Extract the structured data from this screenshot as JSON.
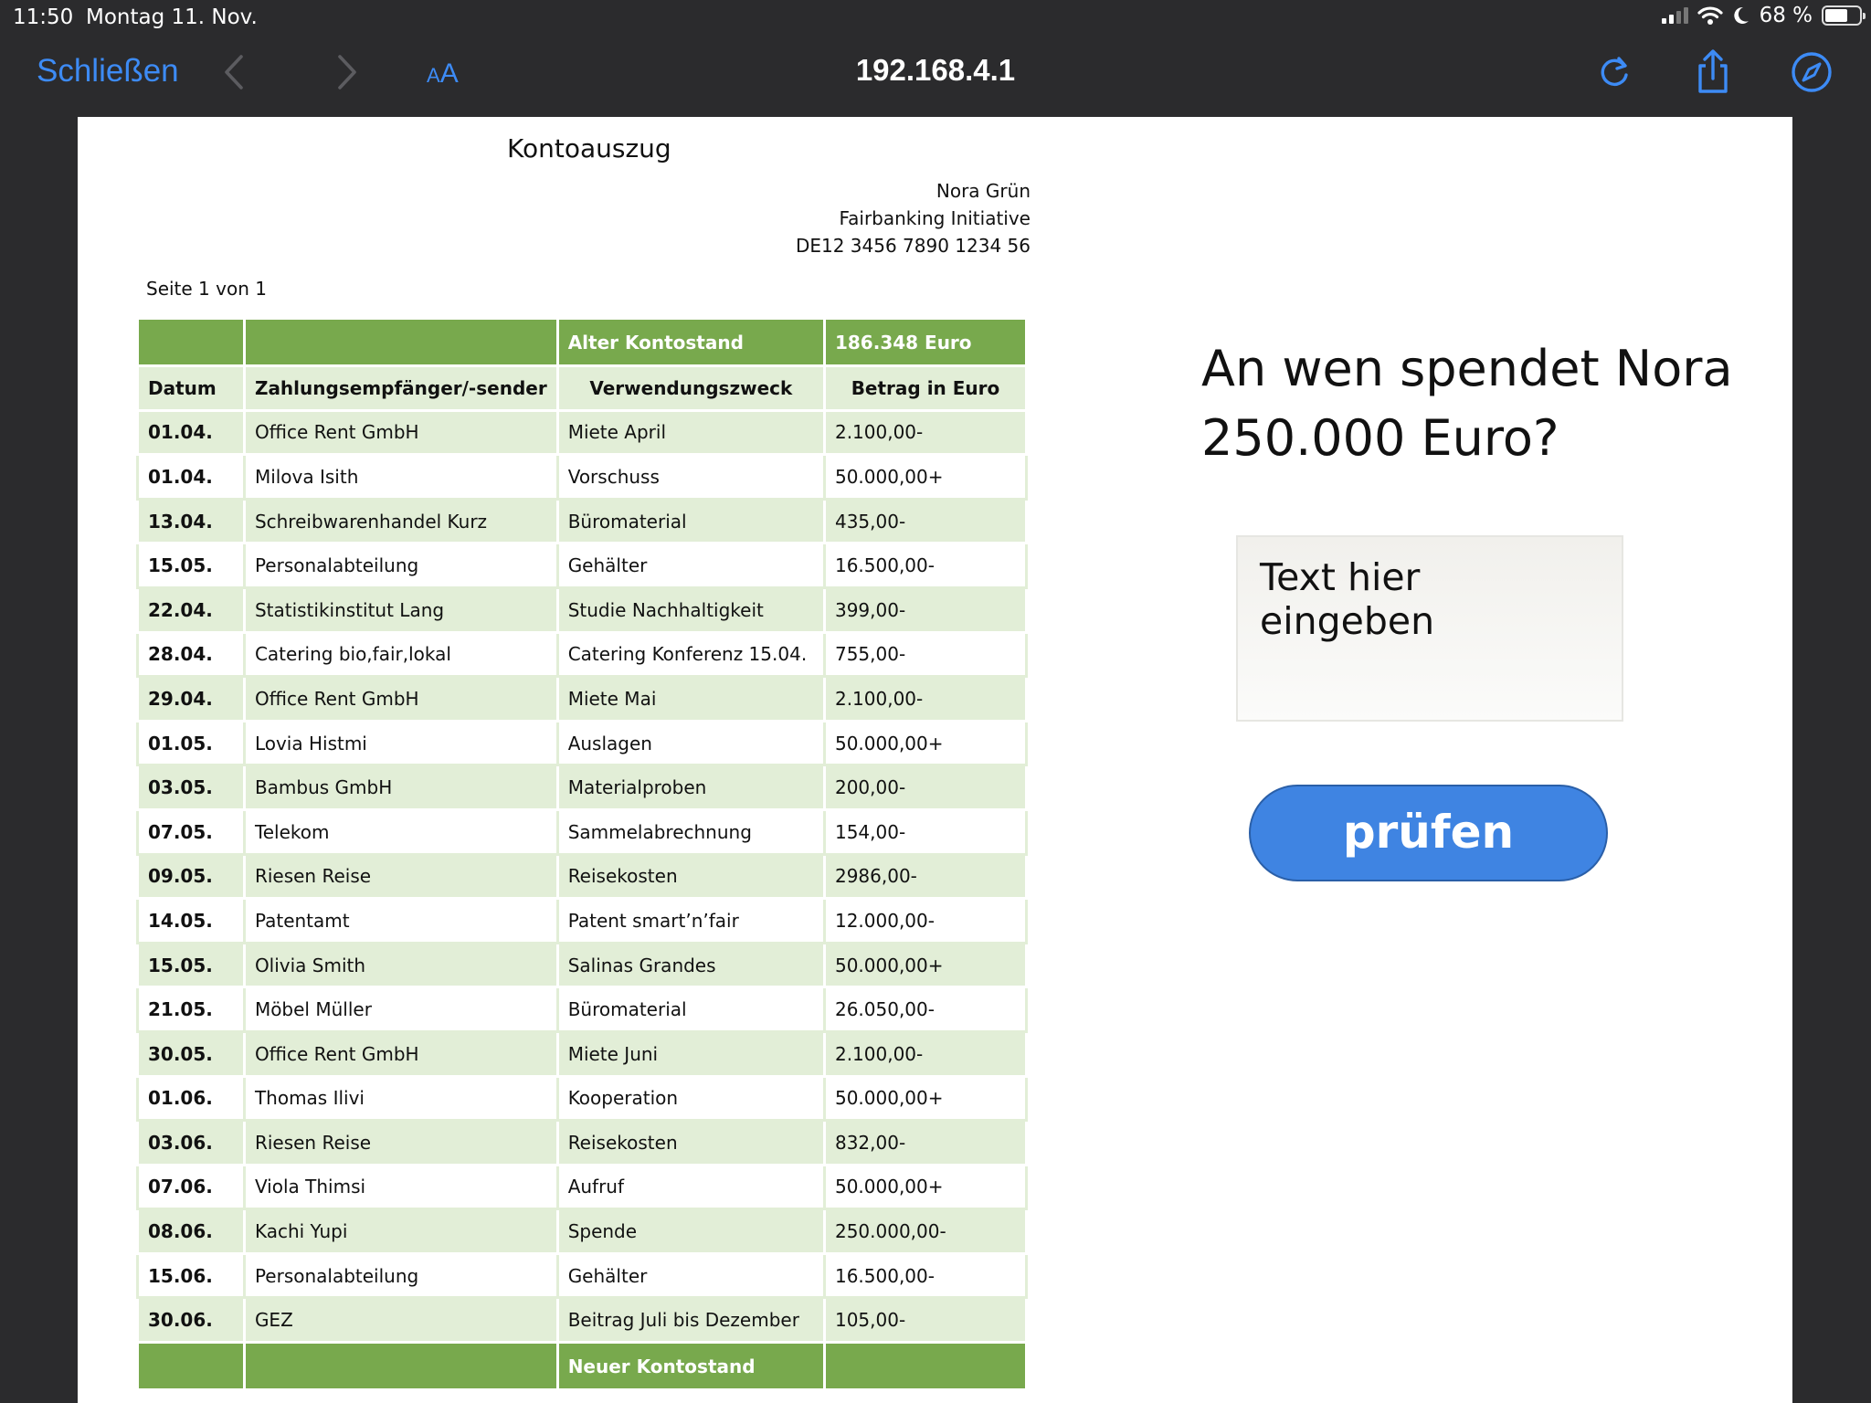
{
  "status_bar": {
    "time": "11:50",
    "date": "Montag 11. Nov.",
    "battery": "68 %",
    "battery_level": 0.68,
    "icons": [
      "cellular-signal-icon",
      "wifi-icon",
      "do-not-disturb-moon-icon",
      "battery-icon"
    ]
  },
  "toolbar": {
    "close_label": "Schließen",
    "text_size_label_small": "A",
    "text_size_label_large": "A",
    "url": "192.168.4.1",
    "icons": [
      "chevron-left-icon",
      "chevron-right-icon",
      "reload-icon",
      "share-icon",
      "compass-icon"
    ],
    "accent_color": "#3d8bf5"
  },
  "document": {
    "title": "Kontoauszug",
    "owner_name": "Nora Grün",
    "organization": "Fairbanking Initiative",
    "iban": "DE12 3456 7890 1234 56",
    "page_label": "Seite 1 von 1",
    "old_balance_label": "Alter Kontostand",
    "old_balance_value": "186.348 Euro",
    "new_balance_label": "Neuer Kontostand",
    "new_balance_value": "",
    "columns": [
      "Datum",
      "Zahlungsempfänger/-sender",
      "Verwendungszweck",
      "Betrag in Euro"
    ],
    "rows": [
      [
        "01.04.",
        "Office Rent GmbH",
        "Miete April",
        "2.100,00-"
      ],
      [
        "01.04.",
        "Milova Isith",
        "Vorschuss",
        "50.000,00+"
      ],
      [
        "13.04.",
        "Schreibwarenhandel Kurz",
        "Büromaterial",
        "435,00-"
      ],
      [
        "15.05.",
        "Personalabteilung",
        "Gehälter",
        "16.500,00-"
      ],
      [
        "22.04.",
        "Statistikinstitut Lang",
        "Studie Nachhaltigkeit",
        "399,00-"
      ],
      [
        "28.04.",
        "Catering bio,fair,lokal",
        "Catering Konferenz 15.04.",
        "755,00-"
      ],
      [
        "29.04.",
        "Office Rent GmbH",
        "Miete Mai",
        "2.100,00-"
      ],
      [
        "01.05.",
        "Lovia Histmi",
        "Auslagen",
        "50.000,00+"
      ],
      [
        "03.05.",
        "Bambus GmbH",
        "Materialproben",
        "200,00-"
      ],
      [
        "07.05.",
        "Telekom",
        "Sammelabrechnung",
        "154,00-"
      ],
      [
        "09.05.",
        "Riesen Reise",
        "Reisekosten",
        "2986,00-"
      ],
      [
        "14.05.",
        "Patentamt",
        "Patent smart’n’fair",
        "12.000,00-"
      ],
      [
        "15.05.",
        "Olivia Smith",
        "Salinas Grandes",
        "50.000,00+"
      ],
      [
        "21.05.",
        "Möbel Müller",
        "Büromaterial",
        "26.050,00-"
      ],
      [
        "30.05.",
        "Office Rent GmbH",
        "Miete Juni",
        "2.100,00-"
      ],
      [
        "01.06.",
        "Thomas Ilivi",
        "Kooperation",
        "50.000,00+"
      ],
      [
        "03.06.",
        "Riesen Reise",
        "Reisekosten",
        "832,00-"
      ],
      [
        "07.06.",
        "Viola Thimsi",
        "Aufruf",
        "50.000,00+"
      ],
      [
        "08.06.",
        "Kachi Yupi",
        "Spende",
        "250.000,00-"
      ],
      [
        "15.06.",
        "Personalabteilung",
        "Gehälter",
        "16.500,00-"
      ],
      [
        "30.06.",
        "GEZ",
        "Beitrag Juli bis Dezember",
        "105,00-"
      ]
    ],
    "band_color": "#78a94d",
    "stripe_color": "#e2eed7"
  },
  "quiz": {
    "question": "An wen spendet Nora 250.000 Euro?",
    "answer_value": "",
    "answer_placeholder": "Text hier eingeben",
    "check_label": "prüfen",
    "button_color": "#3f84e2"
  }
}
